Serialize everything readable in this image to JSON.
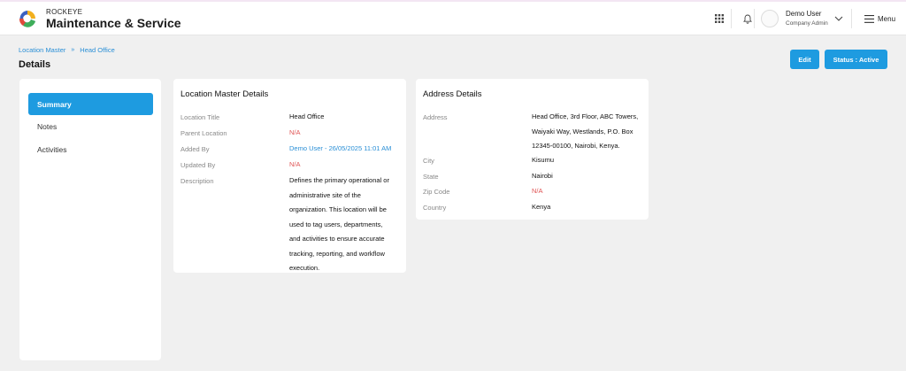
{
  "header": {
    "brand_small": "ROCKEYE",
    "brand_title": "Maintenance & Service",
    "user_name": "Demo User",
    "user_role": "Company Admin",
    "menu_label": "Menu",
    "icons": [
      "grid-icon",
      "bell-icon",
      "chevron-down-icon",
      "hamburger-menu-icon"
    ]
  },
  "breadcrumb": {
    "items": [
      "Location Master",
      "Head Office"
    ],
    "separator": "»"
  },
  "page": {
    "title": "Details"
  },
  "actions": {
    "edit_label": "Edit",
    "status_label": "Status : Active"
  },
  "sidebar": {
    "items": [
      {
        "label": "Summary",
        "active": true
      },
      {
        "label": "Notes",
        "active": false
      },
      {
        "label": "Activities",
        "active": false
      }
    ]
  },
  "location_details": {
    "title": "Location Master Details",
    "rows": [
      {
        "label": "Location Title",
        "value": "Head Office"
      },
      {
        "label": "Parent Location",
        "value": "N/A"
      },
      {
        "label": "Added By",
        "value": "Demo User - 26/05/2025 11:01 AM"
      },
      {
        "label": "Updated By",
        "value": "N/A"
      },
      {
        "label": "Description",
        "value_lines": [
          "Defines the primary operational or",
          "administrative site of the",
          "organization. This location will be",
          "used to tag users, departments,",
          "and activities to ensure accurate",
          "tracking, reporting, and workflow",
          "execution."
        ]
      }
    ]
  },
  "address_details": {
    "title": "Address Details",
    "rows": [
      {
        "label": "Address",
        "value_lines": [
          "Head Office, 3rd Floor, ABC Towers,",
          "Waiyaki Way, Westlands, P.O. Box",
          "12345-00100, Nairobi, Kenya."
        ]
      },
      {
        "label": "City",
        "value": "Kisumu"
      },
      {
        "label": "State",
        "value": "Nairobi"
      },
      {
        "label": "Zip Code",
        "value": "N/A"
      },
      {
        "label": "Country",
        "value": "Kenya"
      }
    ]
  },
  "colors": {
    "accent": "#1e9be0",
    "link": "#2a8fd6",
    "na": "#e05555",
    "background": "#f0f0f0"
  }
}
